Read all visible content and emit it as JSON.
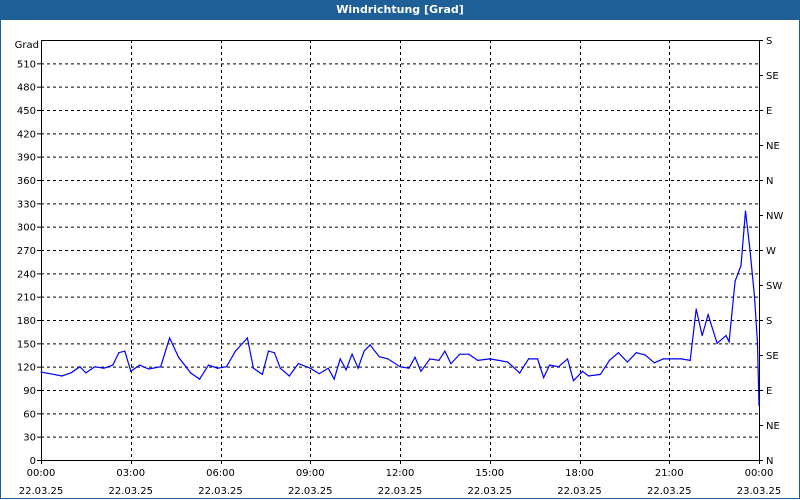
{
  "title": "Windrichtung [Grad]",
  "chart_data": {
    "type": "line",
    "title": "Windrichtung [Grad]",
    "ylabel": "Grad",
    "ylim": [
      0,
      540
    ],
    "y_ticks": [
      0,
      30,
      60,
      90,
      120,
      150,
      180,
      210,
      240,
      270,
      300,
      330,
      360,
      390,
      420,
      450,
      480,
      510
    ],
    "right_ticks": [
      {
        "value": 0,
        "label": "N"
      },
      {
        "value": 45,
        "label": "NE"
      },
      {
        "value": 90,
        "label": "E"
      },
      {
        "value": 135,
        "label": "SE"
      },
      {
        "value": 180,
        "label": "S"
      },
      {
        "value": 225,
        "label": "SW"
      },
      {
        "value": 270,
        "label": "W"
      },
      {
        "value": 315,
        "label": "NW"
      },
      {
        "value": 360,
        "label": "N"
      },
      {
        "value": 405,
        "label": "NE"
      },
      {
        "value": 450,
        "label": "E"
      },
      {
        "value": 495,
        "label": "SE"
      },
      {
        "value": 540,
        "label": "S"
      }
    ],
    "xlim_hours": [
      0,
      24
    ],
    "x_ticks": [
      {
        "hour": 0,
        "time": "00:00",
        "date": "22.03.25"
      },
      {
        "hour": 3,
        "time": "03:00",
        "date": "22.03.25"
      },
      {
        "hour": 6,
        "time": "06:00",
        "date": "22.03.25"
      },
      {
        "hour": 9,
        "time": "09:00",
        "date": "22.03.25"
      },
      {
        "hour": 12,
        "time": "12:00",
        "date": "22.03.25"
      },
      {
        "hour": 15,
        "time": "15:00",
        "date": "22.03.25"
      },
      {
        "hour": 18,
        "time": "18:00",
        "date": "22.03.25"
      },
      {
        "hour": 21,
        "time": "21:00",
        "date": "22.03.25"
      },
      {
        "hour": 24,
        "time": "00:00",
        "date": "23.03.25"
      }
    ],
    "grid": true,
    "line_color": "#0000ff",
    "series": [
      {
        "name": "Windrichtung",
        "points": [
          [
            0,
            113
          ],
          [
            0.3,
            111
          ],
          [
            0.7,
            108
          ],
          [
            1.0,
            112
          ],
          [
            1.3,
            120
          ],
          [
            1.5,
            112
          ],
          [
            1.8,
            120
          ],
          [
            2.1,
            118
          ],
          [
            2.4,
            122
          ],
          [
            2.6,
            138
          ],
          [
            2.8,
            140
          ],
          [
            3.0,
            114
          ],
          [
            3.3,
            122
          ],
          [
            3.6,
            117
          ],
          [
            4.0,
            120
          ],
          [
            4.3,
            157
          ],
          [
            4.6,
            132
          ],
          [
            5.0,
            112
          ],
          [
            5.3,
            104
          ],
          [
            5.6,
            122
          ],
          [
            5.9,
            118
          ],
          [
            6.2,
            120
          ],
          [
            6.5,
            140
          ],
          [
            6.9,
            157
          ],
          [
            7.1,
            118
          ],
          [
            7.4,
            110
          ],
          [
            7.6,
            140
          ],
          [
            7.8,
            138
          ],
          [
            8.0,
            118
          ],
          [
            8.3,
            108
          ],
          [
            8.6,
            124
          ],
          [
            9.0,
            118
          ],
          [
            9.3,
            111
          ],
          [
            9.6,
            118
          ],
          [
            9.8,
            104
          ],
          [
            10.0,
            130
          ],
          [
            10.2,
            116
          ],
          [
            10.4,
            136
          ],
          [
            10.6,
            118
          ],
          [
            10.8,
            140
          ],
          [
            11.0,
            148
          ],
          [
            11.3,
            133
          ],
          [
            11.6,
            130
          ],
          [
            12.0,
            120
          ],
          [
            12.3,
            118
          ],
          [
            12.5,
            132
          ],
          [
            12.7,
            114
          ],
          [
            13.0,
            130
          ],
          [
            13.3,
            128
          ],
          [
            13.5,
            140
          ],
          [
            13.7,
            124
          ],
          [
            14.0,
            136
          ],
          [
            14.3,
            136
          ],
          [
            14.6,
            128
          ],
          [
            15.0,
            130
          ],
          [
            15.3,
            128
          ],
          [
            15.6,
            126
          ],
          [
            16.0,
            112
          ],
          [
            16.3,
            130
          ],
          [
            16.6,
            130
          ],
          [
            16.8,
            106
          ],
          [
            17.0,
            122
          ],
          [
            17.3,
            120
          ],
          [
            17.6,
            130
          ],
          [
            17.8,
            102
          ],
          [
            18.1,
            114
          ],
          [
            18.3,
            108
          ],
          [
            18.7,
            110
          ],
          [
            19.0,
            128
          ],
          [
            19.3,
            138
          ],
          [
            19.6,
            126
          ],
          [
            19.9,
            138
          ],
          [
            20.2,
            135
          ],
          [
            20.5,
            125
          ],
          [
            20.8,
            130
          ],
          [
            21.1,
            130
          ],
          [
            21.4,
            130
          ],
          [
            21.7,
            128
          ],
          [
            21.9,
            194
          ],
          [
            22.1,
            160
          ],
          [
            22.3,
            187
          ],
          [
            22.6,
            150
          ],
          [
            22.9,
            160
          ],
          [
            23.0,
            152
          ],
          [
            23.2,
            230
          ],
          [
            23.4,
            250
          ],
          [
            23.55,
            320
          ],
          [
            23.7,
            270
          ],
          [
            23.85,
            210
          ],
          [
            23.95,
            150
          ],
          [
            24.0,
            70
          ]
        ]
      }
    ]
  }
}
